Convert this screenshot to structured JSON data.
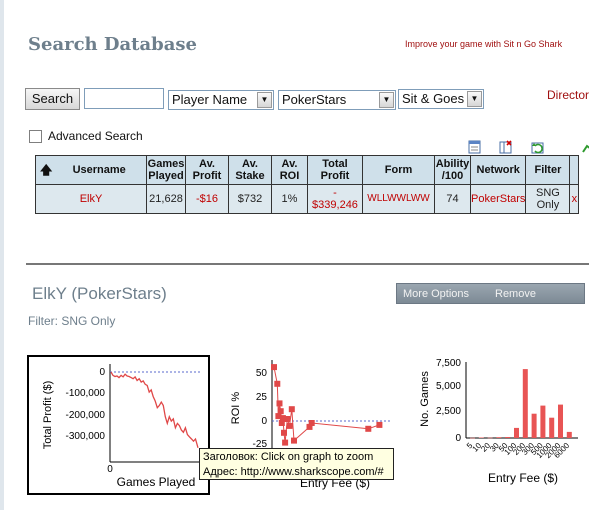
{
  "page": {
    "title": "Search Database",
    "promo": "Improve your game with Sit n Go Shark",
    "director": "Director"
  },
  "search": {
    "button": "Search",
    "input_value": "",
    "type_select": "Player Name",
    "network_select": "PokerStars",
    "game_select": "Sit & Goes",
    "advanced_label": "Advanced Search"
  },
  "table": {
    "headers": [
      "Username",
      "Games Played",
      "Av. Profit",
      "Av. Stake",
      "Av. ROI",
      "Total Profit",
      "Form",
      "Ability /100",
      "Network",
      "Filter",
      ""
    ],
    "row": {
      "username": "ElkY",
      "games": "21,628",
      "avprofit": "-$16",
      "avstake": "$732",
      "avroi": "1%",
      "total_a": "-",
      "total_b": "$339,246",
      "form": "WLLWWLWW",
      "ability": "74",
      "network": "PokerStars",
      "filter_a": "SNG",
      "filter_b": "Only",
      "remove": "x"
    }
  },
  "player": {
    "title": "ElkY (PokerStars)",
    "filter": "Filter: SNG Only",
    "more_options": "More Options",
    "remove": "Remove"
  },
  "chart_data": [
    {
      "type": "line",
      "ylabel": "Total Profit ($)",
      "xlabel": "Games Played",
      "yticks": [
        "0",
        "-100,000",
        "-200,000",
        "-300,000"
      ],
      "xticks": [
        "0"
      ],
      "ylim": [
        -339246,
        15000
      ],
      "x": [
        0,
        500,
        1000,
        1500,
        2000,
        2500,
        3000,
        3500,
        4000,
        4500,
        5000,
        5500,
        6000,
        6500,
        7000,
        7500,
        8000,
        8500,
        9000,
        9500,
        10000,
        10500,
        11000,
        11500,
        12000,
        12500,
        13000,
        13500,
        14000,
        14500,
        15000,
        15500,
        16000,
        16500,
        17000,
        17500,
        18000,
        18500,
        19000,
        19500,
        20000,
        20500,
        21000,
        21628
      ],
      "values": [
        0,
        -15000,
        -20000,
        -18000,
        -25000,
        -15000,
        -22000,
        -10000,
        -18000,
        -20000,
        -25000,
        -30000,
        -22000,
        -38000,
        -30000,
        -45000,
        -40000,
        -55000,
        -60000,
        -90000,
        -80000,
        -110000,
        -130000,
        -160000,
        -150000,
        -135000,
        -150000,
        -200000,
        -230000,
        -200000,
        -220000,
        -210000,
        -250000,
        -230000,
        -240000,
        -260000,
        -270000,
        -250000,
        -280000,
        -290000,
        -300000,
        -310000,
        -300000,
        -339246
      ]
    },
    {
      "type": "scatter",
      "ylabel": "ROI %",
      "xlabel": "Entry Fee ($)",
      "yticks": [
        "50",
        "25",
        "0",
        "-25"
      ],
      "ylim": [
        -35,
        55
      ],
      "points": [
        [
          0,
          55
        ],
        [
          0.03,
          38
        ],
        [
          0.04,
          5
        ],
        [
          0.05,
          18
        ],
        [
          0.06,
          10
        ],
        [
          0.07,
          -2
        ],
        [
          0.08,
          3
        ],
        [
          0.09,
          -12
        ],
        [
          0.1,
          -22
        ],
        [
          0.12,
          2
        ],
        [
          0.14,
          -5
        ],
        [
          0.16,
          12
        ],
        [
          0.18,
          -20
        ],
        [
          0.32,
          -6
        ],
        [
          0.34,
          -2
        ],
        [
          0.85,
          -8
        ],
        [
          0.95,
          -4
        ]
      ]
    },
    {
      "type": "bar",
      "ylabel": "No. Games",
      "xlabel": "Entry Fee ($)",
      "yticks": [
        "7,500",
        "5,000",
        "2,500",
        "0"
      ],
      "ylim": [
        0,
        7500
      ],
      "xticks": [
        "5",
        "10",
        "20",
        "30",
        "50",
        "100",
        "200",
        "300",
        "500",
        "1000",
        "2000",
        "6000"
      ],
      "values": [
        20,
        50,
        30,
        80,
        100,
        1000,
        6800,
        2400,
        3200,
        2000,
        3300,
        600
      ]
    }
  ],
  "tooltip": {
    "line1": "Заголовок: Click on graph to zoom",
    "line2": "Адрес: http://www.sharkscope.com/#"
  }
}
